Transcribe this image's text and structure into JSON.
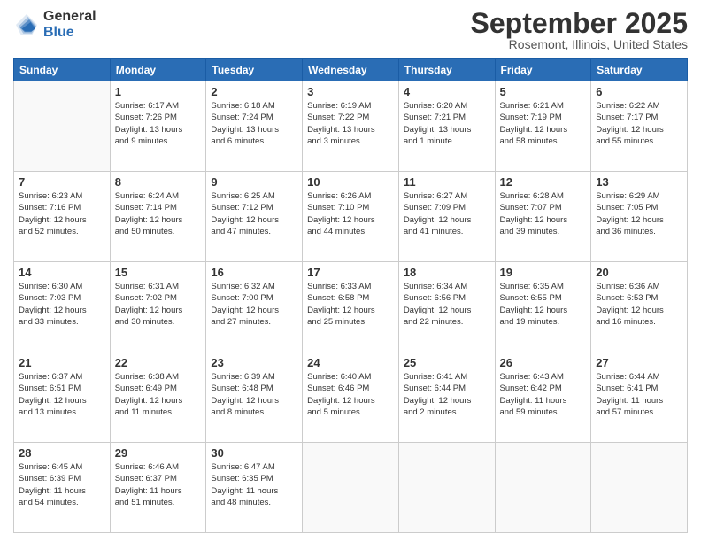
{
  "logo": {
    "general": "General",
    "blue": "Blue"
  },
  "title": "September 2025",
  "location": "Rosemont, Illinois, United States",
  "days_header": [
    "Sunday",
    "Monday",
    "Tuesday",
    "Wednesday",
    "Thursday",
    "Friday",
    "Saturday"
  ],
  "weeks": [
    [
      {
        "num": "",
        "info": ""
      },
      {
        "num": "1",
        "info": "Sunrise: 6:17 AM\nSunset: 7:26 PM\nDaylight: 13 hours\nand 9 minutes."
      },
      {
        "num": "2",
        "info": "Sunrise: 6:18 AM\nSunset: 7:24 PM\nDaylight: 13 hours\nand 6 minutes."
      },
      {
        "num": "3",
        "info": "Sunrise: 6:19 AM\nSunset: 7:22 PM\nDaylight: 13 hours\nand 3 minutes."
      },
      {
        "num": "4",
        "info": "Sunrise: 6:20 AM\nSunset: 7:21 PM\nDaylight: 13 hours\nand 1 minute."
      },
      {
        "num": "5",
        "info": "Sunrise: 6:21 AM\nSunset: 7:19 PM\nDaylight: 12 hours\nand 58 minutes."
      },
      {
        "num": "6",
        "info": "Sunrise: 6:22 AM\nSunset: 7:17 PM\nDaylight: 12 hours\nand 55 minutes."
      }
    ],
    [
      {
        "num": "7",
        "info": "Sunrise: 6:23 AM\nSunset: 7:16 PM\nDaylight: 12 hours\nand 52 minutes."
      },
      {
        "num": "8",
        "info": "Sunrise: 6:24 AM\nSunset: 7:14 PM\nDaylight: 12 hours\nand 50 minutes."
      },
      {
        "num": "9",
        "info": "Sunrise: 6:25 AM\nSunset: 7:12 PM\nDaylight: 12 hours\nand 47 minutes."
      },
      {
        "num": "10",
        "info": "Sunrise: 6:26 AM\nSunset: 7:10 PM\nDaylight: 12 hours\nand 44 minutes."
      },
      {
        "num": "11",
        "info": "Sunrise: 6:27 AM\nSunset: 7:09 PM\nDaylight: 12 hours\nand 41 minutes."
      },
      {
        "num": "12",
        "info": "Sunrise: 6:28 AM\nSunset: 7:07 PM\nDaylight: 12 hours\nand 39 minutes."
      },
      {
        "num": "13",
        "info": "Sunrise: 6:29 AM\nSunset: 7:05 PM\nDaylight: 12 hours\nand 36 minutes."
      }
    ],
    [
      {
        "num": "14",
        "info": "Sunrise: 6:30 AM\nSunset: 7:03 PM\nDaylight: 12 hours\nand 33 minutes."
      },
      {
        "num": "15",
        "info": "Sunrise: 6:31 AM\nSunset: 7:02 PM\nDaylight: 12 hours\nand 30 minutes."
      },
      {
        "num": "16",
        "info": "Sunrise: 6:32 AM\nSunset: 7:00 PM\nDaylight: 12 hours\nand 27 minutes."
      },
      {
        "num": "17",
        "info": "Sunrise: 6:33 AM\nSunset: 6:58 PM\nDaylight: 12 hours\nand 25 minutes."
      },
      {
        "num": "18",
        "info": "Sunrise: 6:34 AM\nSunset: 6:56 PM\nDaylight: 12 hours\nand 22 minutes."
      },
      {
        "num": "19",
        "info": "Sunrise: 6:35 AM\nSunset: 6:55 PM\nDaylight: 12 hours\nand 19 minutes."
      },
      {
        "num": "20",
        "info": "Sunrise: 6:36 AM\nSunset: 6:53 PM\nDaylight: 12 hours\nand 16 minutes."
      }
    ],
    [
      {
        "num": "21",
        "info": "Sunrise: 6:37 AM\nSunset: 6:51 PM\nDaylight: 12 hours\nand 13 minutes."
      },
      {
        "num": "22",
        "info": "Sunrise: 6:38 AM\nSunset: 6:49 PM\nDaylight: 12 hours\nand 11 minutes."
      },
      {
        "num": "23",
        "info": "Sunrise: 6:39 AM\nSunset: 6:48 PM\nDaylight: 12 hours\nand 8 minutes."
      },
      {
        "num": "24",
        "info": "Sunrise: 6:40 AM\nSunset: 6:46 PM\nDaylight: 12 hours\nand 5 minutes."
      },
      {
        "num": "25",
        "info": "Sunrise: 6:41 AM\nSunset: 6:44 PM\nDaylight: 12 hours\nand 2 minutes."
      },
      {
        "num": "26",
        "info": "Sunrise: 6:43 AM\nSunset: 6:42 PM\nDaylight: 11 hours\nand 59 minutes."
      },
      {
        "num": "27",
        "info": "Sunrise: 6:44 AM\nSunset: 6:41 PM\nDaylight: 11 hours\nand 57 minutes."
      }
    ],
    [
      {
        "num": "28",
        "info": "Sunrise: 6:45 AM\nSunset: 6:39 PM\nDaylight: 11 hours\nand 54 minutes."
      },
      {
        "num": "29",
        "info": "Sunrise: 6:46 AM\nSunset: 6:37 PM\nDaylight: 11 hours\nand 51 minutes."
      },
      {
        "num": "30",
        "info": "Sunrise: 6:47 AM\nSunset: 6:35 PM\nDaylight: 11 hours\nand 48 minutes."
      },
      {
        "num": "",
        "info": ""
      },
      {
        "num": "",
        "info": ""
      },
      {
        "num": "",
        "info": ""
      },
      {
        "num": "",
        "info": ""
      }
    ]
  ]
}
